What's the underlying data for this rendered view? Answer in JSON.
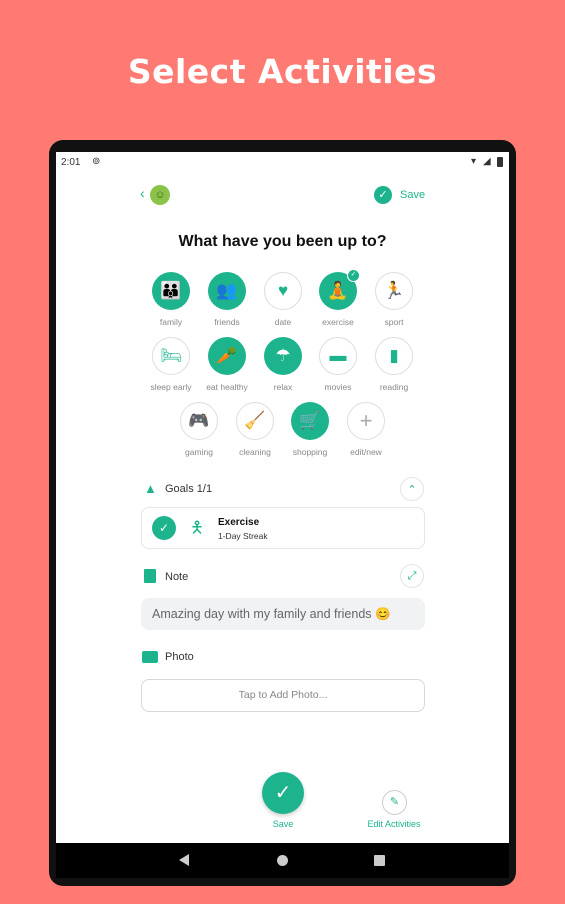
{
  "headline": "Select Activities",
  "status_bar": {
    "time": "2:01"
  },
  "header": {
    "save_label": "Save"
  },
  "title": "What have you been up to?",
  "activities": [
    {
      "label": "family",
      "icon": "family-icon",
      "selected": true
    },
    {
      "label": "friends",
      "icon": "friends-icon",
      "selected": true
    },
    {
      "label": "date",
      "icon": "heart-icon",
      "selected": false
    },
    {
      "label": "exercise",
      "icon": "exercise-icon",
      "selected": true
    },
    {
      "label": "sport",
      "icon": "running-icon",
      "selected": false
    },
    {
      "label": "sleep early",
      "icon": "bed-icon",
      "selected": false
    },
    {
      "label": "eat healthy",
      "icon": "carrot-icon",
      "selected": true
    },
    {
      "label": "relax",
      "icon": "umbrella-icon",
      "selected": true
    },
    {
      "label": "movies",
      "icon": "tv-icon",
      "selected": false
    },
    {
      "label": "reading",
      "icon": "book-icon",
      "selected": false
    },
    {
      "label": "gaming",
      "icon": "gamepad-icon",
      "selected": false
    },
    {
      "label": "cleaning",
      "icon": "broom-icon",
      "selected": false
    },
    {
      "label": "shopping",
      "icon": "cart-icon",
      "selected": true
    },
    {
      "label": "edit/new",
      "icon": "plus-icon",
      "selected": false
    }
  ],
  "goals": {
    "label": "Goals 1/1",
    "item_title": "Exercise",
    "item_sub": "1-Day Streak"
  },
  "note": {
    "label": "Note",
    "text": "Amazing day with my family and friends 😊"
  },
  "photo": {
    "label": "Photo",
    "button": "Tap to Add Photo..."
  },
  "bottom": {
    "save_label": "Save",
    "edit_label": "Edit Activities"
  },
  "colors": {
    "background": "#FF7A72",
    "accent": "#1DB48D"
  }
}
